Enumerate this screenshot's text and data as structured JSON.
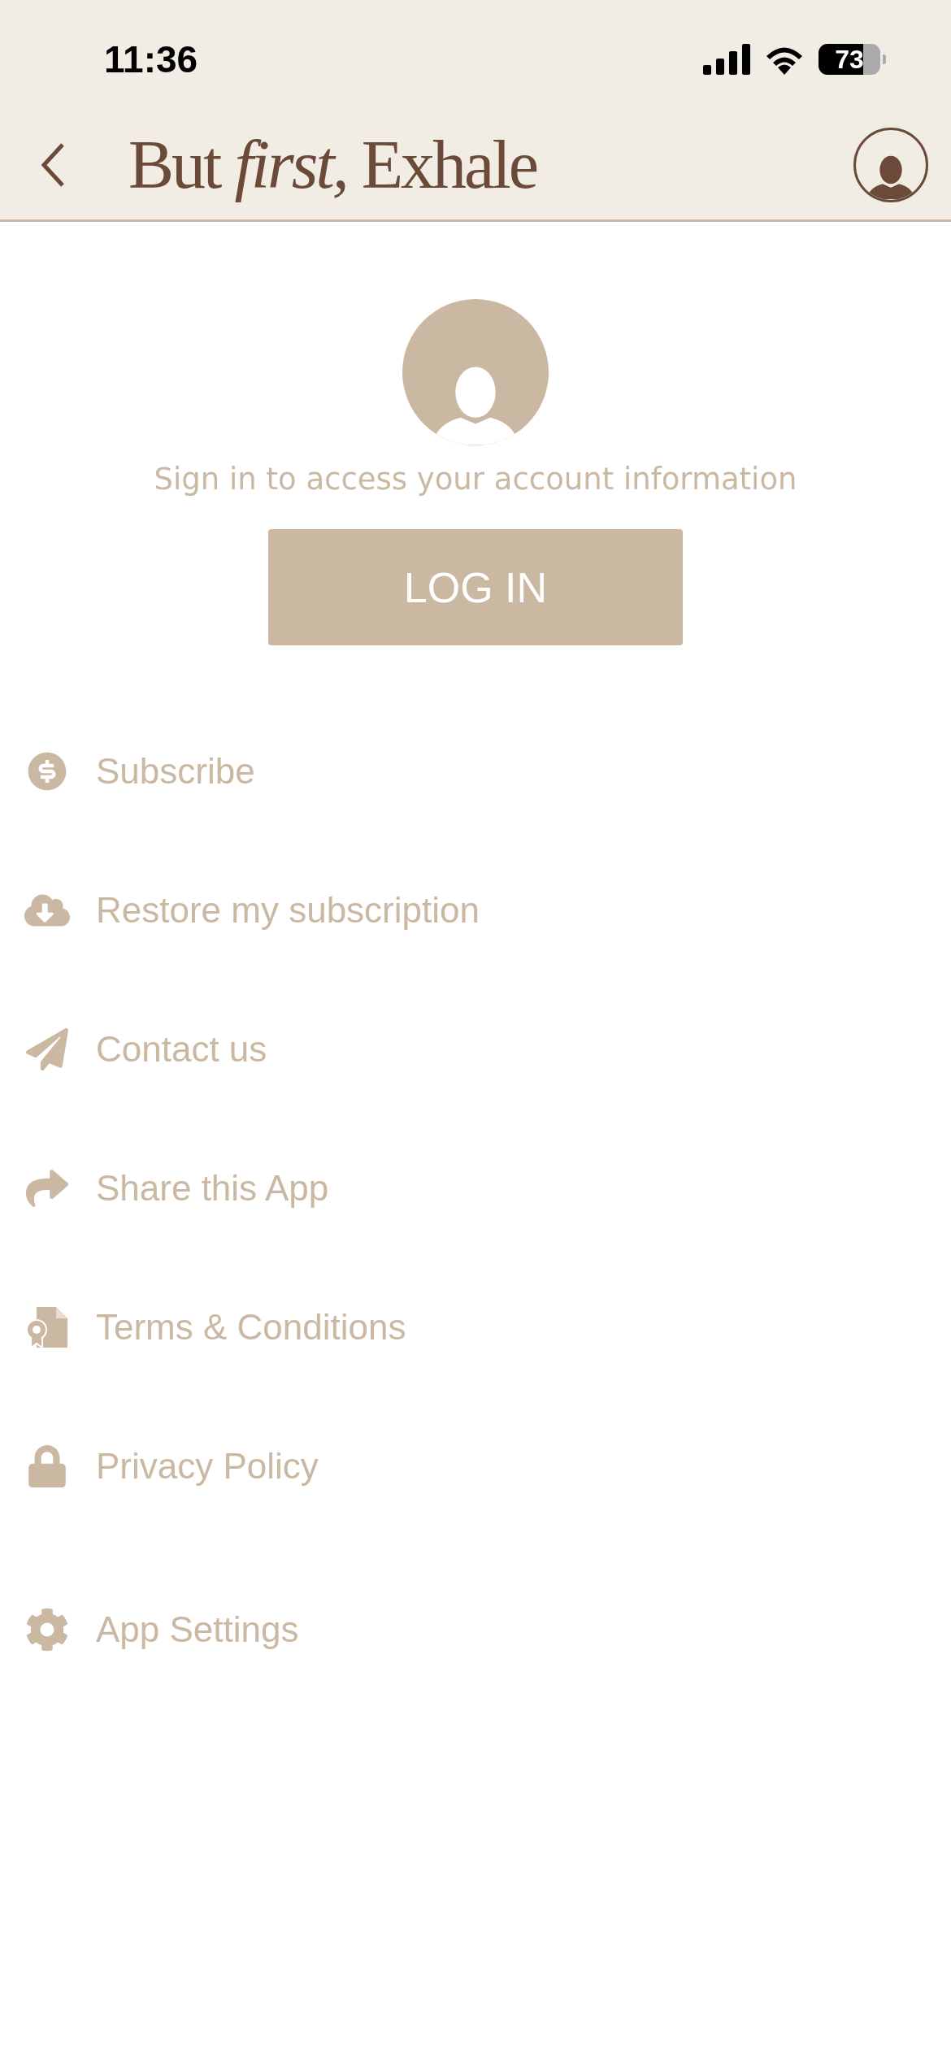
{
  "status_bar": {
    "time": "11:36",
    "battery": "73"
  },
  "header": {
    "logo": "But *first,* Exhale"
  },
  "account": {
    "prompt": "Sign in to access your account information",
    "login_button": "LOG IN"
  },
  "menu": [
    {
      "label": "Subscribe",
      "kind": "link"
    },
    {
      "label": "Restore my subscription",
      "kind": "link"
    },
    {
      "label": "Contact us",
      "kind": "link"
    },
    {
      "label": "Share this App",
      "kind": "link"
    },
    {
      "label": "Terms & Conditions",
      "kind": "link"
    },
    {
      "label": "Privacy Policy",
      "kind": "link"
    },
    {
      "label": "App Settings",
      "kind": "settings"
    }
  ]
}
